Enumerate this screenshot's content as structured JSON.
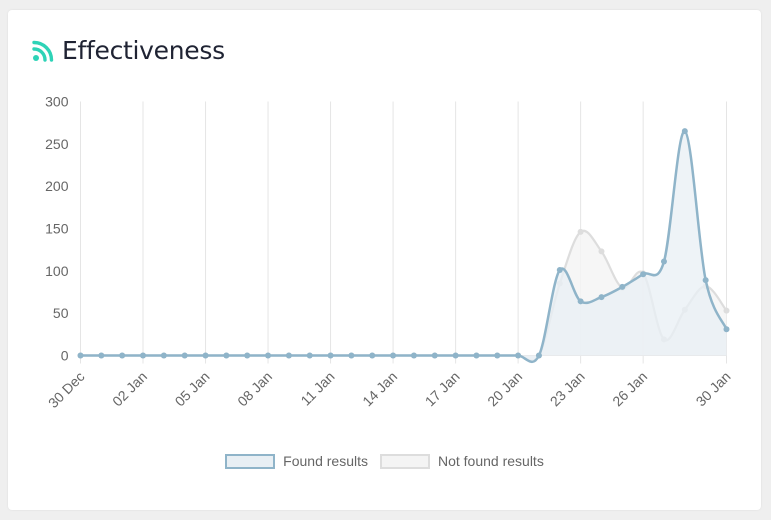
{
  "card": {
    "title": "Effectiveness",
    "icon": "rss-icon",
    "accent": "#2ed3b7"
  },
  "chart_data": {
    "type": "line",
    "title": "",
    "xlabel": "",
    "ylabel": "",
    "ylim": [
      0,
      300
    ],
    "y_ticks": [
      "0",
      "50",
      "100",
      "150",
      "200",
      "250",
      "300"
    ],
    "x_tick_labels": [
      "30 Dec",
      "02 Jan",
      "05 Jan",
      "08 Jan",
      "11 Jan",
      "14 Jan",
      "17 Jan",
      "20 Jan",
      "23 Jan",
      "26 Jan",
      "30 Jan"
    ],
    "x": [
      "30 Dec",
      "31 Dec",
      "01 Jan",
      "02 Jan",
      "03 Jan",
      "04 Jan",
      "05 Jan",
      "06 Jan",
      "07 Jan",
      "08 Jan",
      "09 Jan",
      "10 Jan",
      "11 Jan",
      "12 Jan",
      "13 Jan",
      "14 Jan",
      "15 Jan",
      "16 Jan",
      "17 Jan",
      "18 Jan",
      "19 Jan",
      "20 Jan",
      "21 Jan",
      "22 Jan",
      "23 Jan",
      "24 Jan",
      "25 Jan",
      "26 Jan",
      "27 Jan",
      "28 Jan",
      "29 Jan",
      "30 Jan"
    ],
    "grid": true,
    "legend_position": "bottom",
    "series": [
      {
        "name": "Found results",
        "color": "#8fb4c9",
        "fill": "#e8eff4",
        "values": [
          0,
          0,
          0,
          0,
          0,
          0,
          0,
          0,
          0,
          0,
          0,
          0,
          0,
          0,
          0,
          0,
          0,
          0,
          0,
          0,
          0,
          0,
          0,
          101,
          64,
          69,
          81,
          96,
          111,
          265,
          89,
          31
        ]
      },
      {
        "name": "Not found results",
        "color": "#dddddd",
        "fill": "#f4f4f4",
        "values": [
          0,
          0,
          0,
          0,
          0,
          0,
          0,
          0,
          0,
          0,
          0,
          0,
          0,
          0,
          0,
          0,
          0,
          0,
          0,
          0,
          0,
          0,
          0,
          85,
          146,
          123,
          80,
          97,
          19,
          54,
          82,
          53
        ]
      }
    ]
  }
}
